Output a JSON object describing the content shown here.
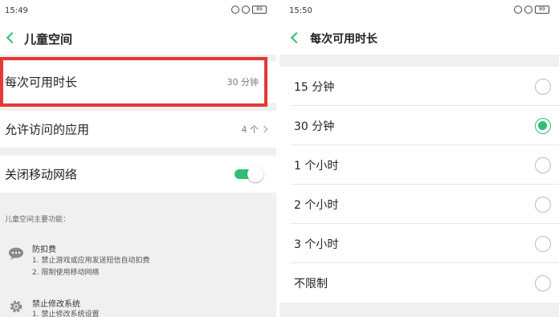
{
  "left": {
    "status": {
      "time": "15:49",
      "battery": "89"
    },
    "title": "儿童空间",
    "settings": [
      {
        "label": "每次可用时长",
        "value": "30 分钟"
      },
      {
        "label": "允许访问的应用",
        "value": "4 个"
      },
      {
        "label": "关闭移动网络",
        "toggle_on": true
      }
    ],
    "features_heading": "儿童空间主要功能：",
    "features": [
      {
        "icon": "chat-bubble-icon",
        "title": "防扣费",
        "lines": [
          "1. 禁止游戏或应用发送短信自动扣费",
          "2. 限制使用移动网络"
        ]
      },
      {
        "icon": "gear-icon",
        "title": "禁止修改系统",
        "lines": [
          "1. 禁止修改系统设置"
        ]
      }
    ]
  },
  "right": {
    "status": {
      "time": "15:50",
      "battery": "89"
    },
    "title": "每次可用时长",
    "options": [
      {
        "label": "15 分钟",
        "selected": false
      },
      {
        "label": "30 分钟",
        "selected": true
      },
      {
        "label": "1 个小时",
        "selected": false
      },
      {
        "label": "2 个小时",
        "selected": false
      },
      {
        "label": "3 个小时",
        "selected": false
      },
      {
        "label": "不限制",
        "selected": false
      }
    ]
  },
  "colors": {
    "accent": "#2fbf71",
    "highlight": "#e53935"
  }
}
